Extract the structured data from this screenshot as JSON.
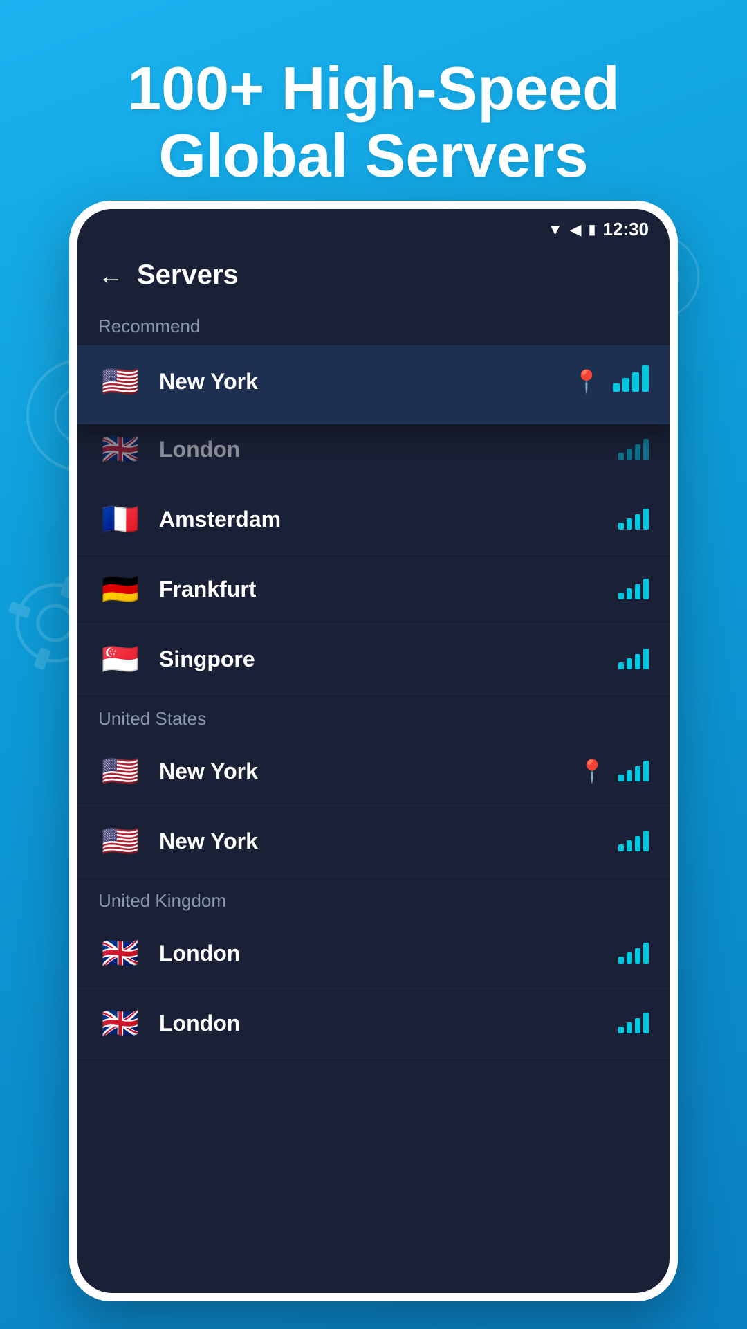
{
  "hero": {
    "title": "100+ High-Speed Global Servers"
  },
  "status_bar": {
    "time": "12:30"
  },
  "app_bar": {
    "title": "Servers",
    "back_label": "←"
  },
  "recommend_label": "Recommend",
  "highlighted_server": {
    "name": "New York",
    "flag": "🇺🇸",
    "has_pin": true,
    "signal": 4
  },
  "recommend_servers": [
    {
      "name": "London",
      "flag": "🇬🇧",
      "signal": 4,
      "dimmed": true
    },
    {
      "name": "Amsterdam",
      "flag": "🇫🇷",
      "signal": 4
    },
    {
      "name": "Frankfurt",
      "flag": "🇩🇪",
      "signal": 4
    },
    {
      "name": "Singpore",
      "flag": "🇸🇬",
      "signal": 4
    }
  ],
  "sections": [
    {
      "label": "United States",
      "servers": [
        {
          "name": "New York",
          "flag": "🇺🇸",
          "has_pin": true,
          "signal": 4
        },
        {
          "name": "New York",
          "flag": "🇺🇸",
          "signal": 4
        }
      ]
    },
    {
      "label": "United Kingdom",
      "servers": [
        {
          "name": "London",
          "flag": "🇬🇧",
          "signal": 4
        },
        {
          "name": "London",
          "flag": "🇬🇧",
          "signal": 4
        }
      ]
    }
  ]
}
